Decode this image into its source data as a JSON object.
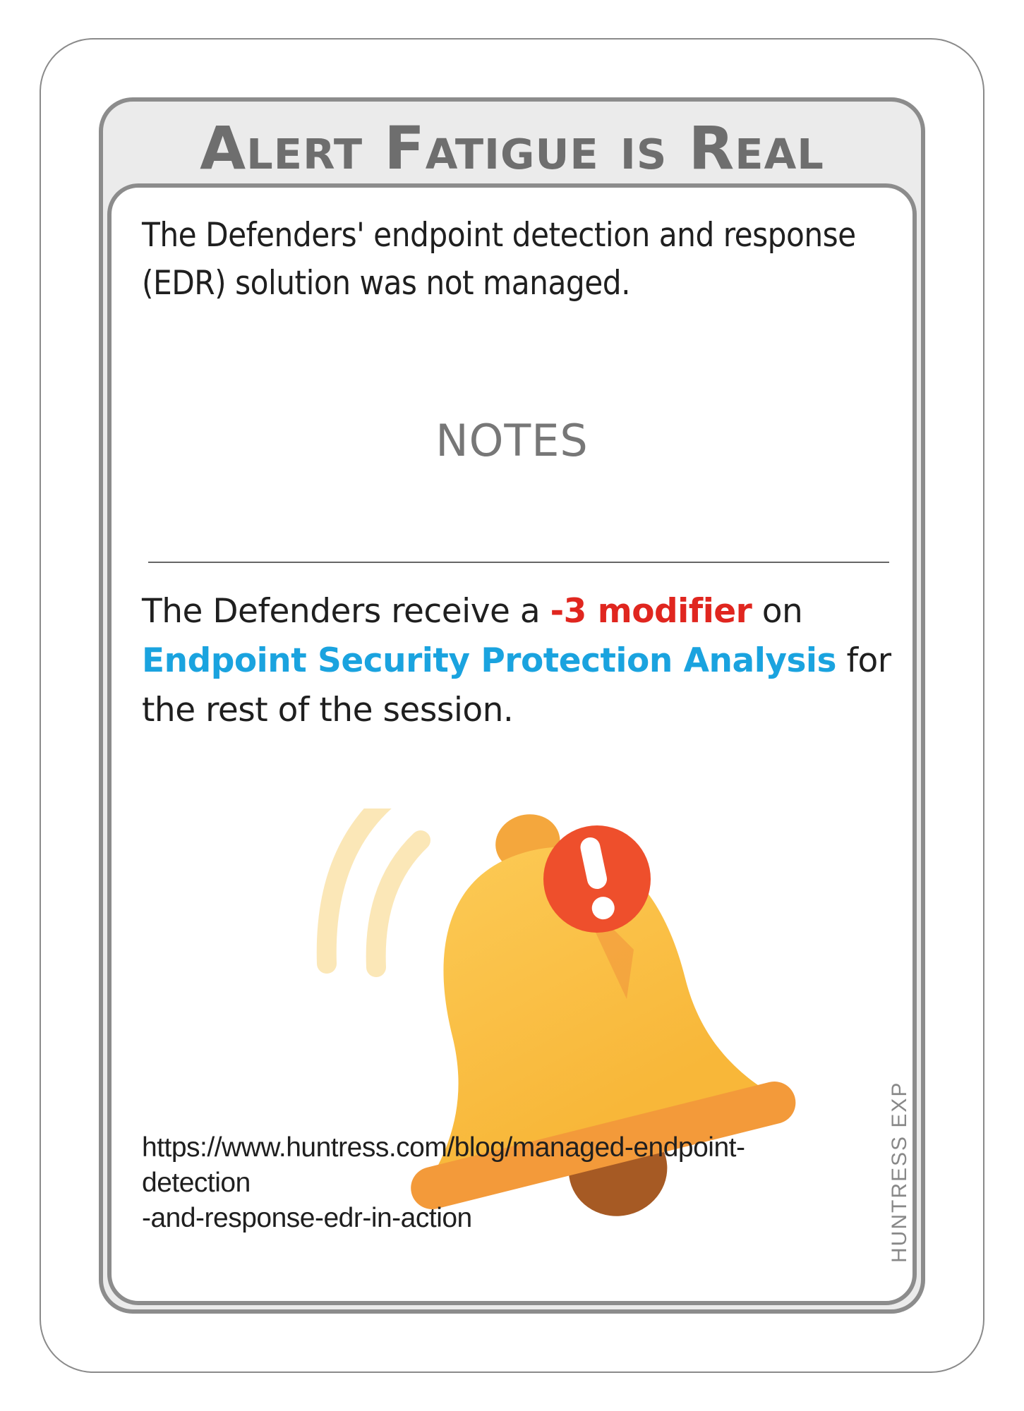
{
  "card": {
    "title": "Alert Fatigue is Real",
    "description": "The Defenders' endpoint detection and response (EDR) solution was not managed.",
    "notes_heading": "NOTES",
    "notes": {
      "prefix": "The Defenders receive a ",
      "modifier": "-3 modifier",
      "middle": " on ",
      "target": "Endpoint Security Protection Analysis",
      "suffix": " for the rest of the session."
    },
    "url_line1": "https://www.huntress.com/blog/managed-endpoint-detection",
    "url_line2": "-and-response-edr-in-action",
    "side_label": "HUNTRESS EXP"
  },
  "illustration": {
    "icon": "alert-bell-icon",
    "badge_icon": "exclamation-icon"
  },
  "colors": {
    "frame": "#8c8c8c",
    "title": "#6e6e6e",
    "modifier": "#e0261f",
    "target": "#1aa3df",
    "bell": "#fbbf42",
    "badge": "#ee4f2c"
  }
}
